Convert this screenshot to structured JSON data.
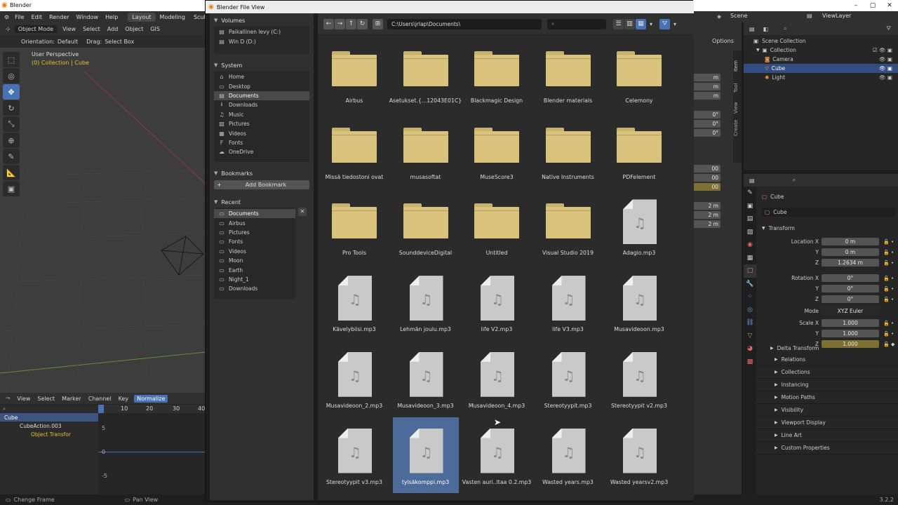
{
  "app": {
    "title": "Blender",
    "version": "3.2.2"
  },
  "topbar": {
    "menus": [
      "File",
      "Edit",
      "Render",
      "Window",
      "Help"
    ],
    "tabs": [
      {
        "label": "Layout",
        "active": true
      },
      {
        "label": "Modeling",
        "active": false
      },
      {
        "label": "Sculptin",
        "active": false
      }
    ],
    "scene": "Scene",
    "view_layer": "ViewLayer"
  },
  "viewport": {
    "mode": "Object Mode",
    "menus": [
      "View",
      "Select",
      "Add",
      "Object",
      "GIS"
    ],
    "orientation_label": "Orientation:",
    "orientation_value": "Default",
    "drag_label": "Drag:",
    "drag_value": "Select Box",
    "overlay_title": "User Perspective",
    "overlay_sub": "(0) Collection | Cube"
  },
  "timeline": {
    "menus": [
      "View",
      "Select",
      "Marker",
      "Channel",
      "Key"
    ],
    "normalize": "Normalize",
    "ticks": [
      "0",
      "10",
      "20",
      "30",
      "40"
    ],
    "yticks": [
      "5",
      "0",
      "-5"
    ],
    "channels": [
      "Cube",
      "CubeAction.003",
      "Object Transfor"
    ]
  },
  "statusbar": {
    "left": "Change Frame",
    "middle": "Pan View"
  },
  "file_browser": {
    "window_title": "Blender File View",
    "path": "C:\\Users\\jrlap\\Documents\\",
    "volumes_header": "Volumes",
    "volumes": [
      "Paikallinen levy (C:)",
      "Win D (D:)"
    ],
    "system_header": "System",
    "system": [
      {
        "label": "Home",
        "icon": "home-icon",
        "glyph": "⌂",
        "selected": false
      },
      {
        "label": "Desktop",
        "icon": "desktop-icon",
        "glyph": "▭",
        "selected": false
      },
      {
        "label": "Documents",
        "icon": "documents-icon",
        "glyph": "▤",
        "selected": true
      },
      {
        "label": "Downloads",
        "icon": "downloads-icon",
        "glyph": "⭳",
        "selected": false
      },
      {
        "label": "Music",
        "icon": "music-icon",
        "glyph": "♫",
        "selected": false
      },
      {
        "label": "Pictures",
        "icon": "pictures-icon",
        "glyph": "▨",
        "selected": false
      },
      {
        "label": "Videos",
        "icon": "videos-icon",
        "glyph": "▦",
        "selected": false
      },
      {
        "label": "Fonts",
        "icon": "fonts-icon",
        "glyph": "F",
        "selected": false
      },
      {
        "label": "OneDrive",
        "icon": "cloud-icon",
        "glyph": "☁",
        "selected": false
      }
    ],
    "bookmarks_header": "Bookmarks",
    "add_bookmark": "Add Bookmark",
    "recent_header": "Recent",
    "recent": [
      "Documents",
      "Airbus",
      "Pictures",
      "Fonts",
      "Videos",
      "Moon",
      "Earth",
      "Night_1",
      "Downloads"
    ],
    "items": [
      {
        "name": "Airbus",
        "type": "folder"
      },
      {
        "name": "Asetukset.{...12043E01C}",
        "type": "folder"
      },
      {
        "name": "Blackmagic Design",
        "type": "folder"
      },
      {
        "name": "Blender materials",
        "type": "folder"
      },
      {
        "name": "Celemony",
        "type": "folder"
      },
      {
        "name": "Missä tiedostoni ovat",
        "type": "folder"
      },
      {
        "name": "musasoftat",
        "type": "folder"
      },
      {
        "name": "MuseScore3",
        "type": "folder"
      },
      {
        "name": "Native Instruments",
        "type": "folder"
      },
      {
        "name": "PDFelement",
        "type": "folder"
      },
      {
        "name": "Pro Tools",
        "type": "folder"
      },
      {
        "name": "SounddeviceDigital",
        "type": "folder"
      },
      {
        "name": "Untitled",
        "type": "folder"
      },
      {
        "name": "Visual Studio 2019",
        "type": "folder"
      },
      {
        "name": "Adagio.mp3",
        "type": "file"
      },
      {
        "name": "Kävelybiisi.mp3",
        "type": "file"
      },
      {
        "name": "Lehmän joulu.mp3",
        "type": "file"
      },
      {
        "name": "life V2.mp3",
        "type": "file"
      },
      {
        "name": "life V3.mp3",
        "type": "file"
      },
      {
        "name": "Musavideoon.mp3",
        "type": "file"
      },
      {
        "name": "Musavideoon_2.mp3",
        "type": "file"
      },
      {
        "name": "Musavideoon_3.mp3",
        "type": "file"
      },
      {
        "name": "Musavideoon_4.mp3",
        "type": "file"
      },
      {
        "name": "Stereotyypit.mp3",
        "type": "file"
      },
      {
        "name": "Stereotyypit v2.mp3",
        "type": "file"
      },
      {
        "name": "Stereotyypit v3.mp3",
        "type": "file"
      },
      {
        "name": "tylsäkomppi.mp3",
        "type": "file",
        "selected": true
      },
      {
        "name": "Vasten auri..ltaa 0.2.mp3",
        "type": "file"
      },
      {
        "name": "Wasted years.mp3",
        "type": "file"
      },
      {
        "name": "Wasted yearsv2.mp3",
        "type": "file"
      }
    ]
  },
  "right_strip": {
    "options": "Options",
    "tabs": [
      "Item",
      "Tool",
      "View",
      "Create"
    ],
    "values": [
      "m",
      "m",
      "m",
      "0°",
      "0°",
      "0°",
      "00",
      "00",
      "00",
      "2 m",
      "2 m",
      "2 m"
    ]
  },
  "outliner": {
    "scene_collection": "Scene Collection",
    "collection": "Collection",
    "objects": [
      {
        "label": "Camera",
        "icon": "camera-icon",
        "selected": false
      },
      {
        "label": "Cube",
        "icon": "cube-icon",
        "selected": true
      },
      {
        "label": "Light",
        "icon": "light-icon",
        "selected": false
      }
    ]
  },
  "properties": {
    "object_name": "Cube",
    "data_name": "Cube",
    "transform_header": "Transform",
    "location_label": "Location X",
    "location": [
      "0 m",
      "0 m",
      "1.2634 m"
    ],
    "rotation_label": "Rotation X",
    "rotation": [
      "0°",
      "0°",
      "0°"
    ],
    "mode_label": "Mode",
    "mode_value": "XYZ Euler",
    "scale_label": "Scale X",
    "scale": [
      "1.000",
      "1.000",
      "1.000"
    ],
    "axis_y": "Y",
    "axis_z": "Z",
    "delta": "Delta Transform",
    "sections": [
      "Relations",
      "Collections",
      "Instancing",
      "Motion Paths",
      "Visibility",
      "Viewport Display",
      "Line Art",
      "Custom Properties"
    ],
    "accent": "#4772b3",
    "keyed_color": "#7d7033"
  }
}
